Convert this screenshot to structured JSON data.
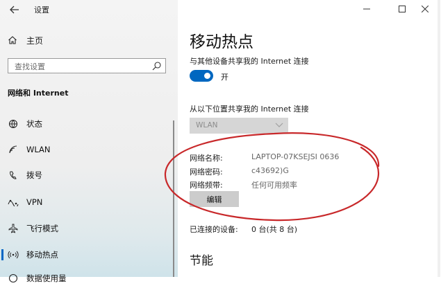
{
  "window": {
    "title": "设置"
  },
  "sidebar": {
    "home_label": "主页",
    "search_placeholder": "查找设置",
    "section_title": "网络和 Internet",
    "items": [
      {
        "label": "状态",
        "icon": "globe-icon"
      },
      {
        "label": "WLAN",
        "icon": "wifi-icon"
      },
      {
        "label": "拨号",
        "icon": "dialup-icon"
      },
      {
        "label": "VPN",
        "icon": "vpn-icon"
      },
      {
        "label": "飞行模式",
        "icon": "airplane-icon"
      },
      {
        "label": "移动热点",
        "icon": "hotspot-icon",
        "active": true
      },
      {
        "label": "数据使用量",
        "icon": "data-usage-icon"
      }
    ]
  },
  "main": {
    "title": "移动热点",
    "share_label": "与其他设备共享我的 Internet 连接",
    "toggle": {
      "state_label": "开",
      "on": true
    },
    "from_label": "从以下位置共享我的 Internet 连接",
    "dropdown_value": "WLAN",
    "network_name_label": "网络名称:",
    "network_name_value": "LAPTOP-07KSEJSI 0636",
    "password_label": "网络密码:",
    "password_value": "c43692)G",
    "band_label": "网络频带:",
    "band_value": "任何可用频率",
    "edit_button": "编辑",
    "connected_label": "已连接的设备:",
    "connected_value": "0 台(共 8 台)",
    "energy_heading": "节能"
  },
  "colors": {
    "accent": "#0067c0",
    "annotation": "#c8282a"
  }
}
